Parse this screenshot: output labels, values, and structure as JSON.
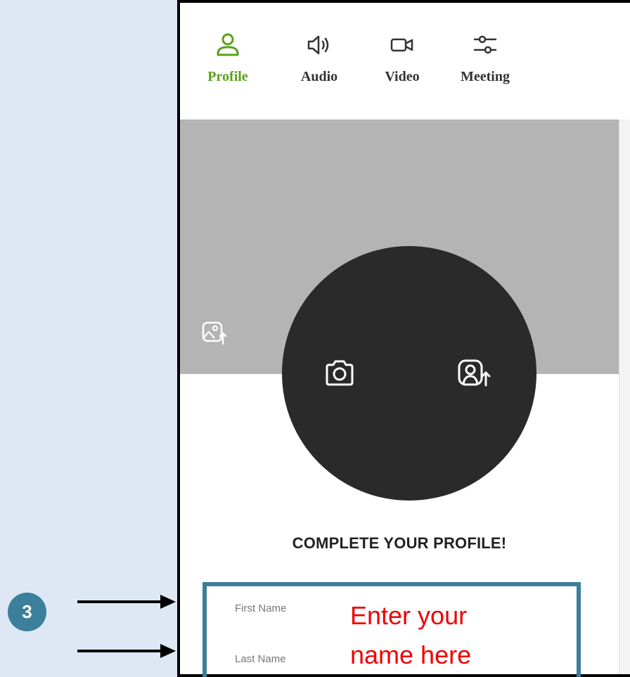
{
  "tabs": [
    {
      "label": "Profile",
      "icon": "user-icon",
      "active": true
    },
    {
      "label": "Audio",
      "icon": "speaker-icon",
      "active": false
    },
    {
      "label": "Video",
      "icon": "video-camera-icon",
      "active": false
    },
    {
      "label": "Meeting",
      "icon": "sliders-icon",
      "active": false
    }
  ],
  "profile": {
    "heading": "COMPLETE YOUR PROFILE!",
    "first_name_label": "First Name",
    "last_name_label": "Last Name",
    "first_name_value": "",
    "last_name_value": ""
  },
  "annotation": {
    "step_number": "3",
    "callout_line1": "Enter your",
    "callout_line2": "name here"
  },
  "colors": {
    "active_tab": "#5aa11a",
    "cover": "#b4b4b4",
    "avatar": "#2a2a2a",
    "highlight": "#3b7f9a",
    "callout_text": "#ee0000",
    "background": "#dde8f4"
  }
}
